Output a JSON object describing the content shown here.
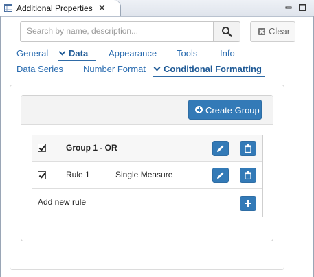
{
  "window": {
    "title": "Additional Properties",
    "close_glyph": "✕",
    "title_icon": "properties-table-icon"
  },
  "search": {
    "placeholder": "Search by name, description...",
    "value": "",
    "button_icon": "search-icon",
    "clear_label": "Clear",
    "clear_icon": "close-square-icon"
  },
  "tabs_row1": [
    {
      "label": "General",
      "active": false
    },
    {
      "label": "Data",
      "active": true
    },
    {
      "label": "Appearance",
      "active": false
    },
    {
      "label": "Tools",
      "active": false
    },
    {
      "label": "Info",
      "active": false
    }
  ],
  "tabs_row2": [
    {
      "label": "Data Series",
      "active": false
    },
    {
      "label": "Number Format",
      "active": false
    },
    {
      "label": "Conditional Formatting",
      "active": true
    }
  ],
  "create_group": {
    "label": "Create Group",
    "icon": "plus-circle-icon"
  },
  "group": {
    "name": "Group 1 - OR",
    "checked": true
  },
  "rules": [
    {
      "name": "Rule 1",
      "type": "Single Measure",
      "checked": true
    }
  ],
  "add_rule_label": "Add new rule",
  "colors": {
    "accent": "#337ab7",
    "link": "#2a6cb0"
  }
}
